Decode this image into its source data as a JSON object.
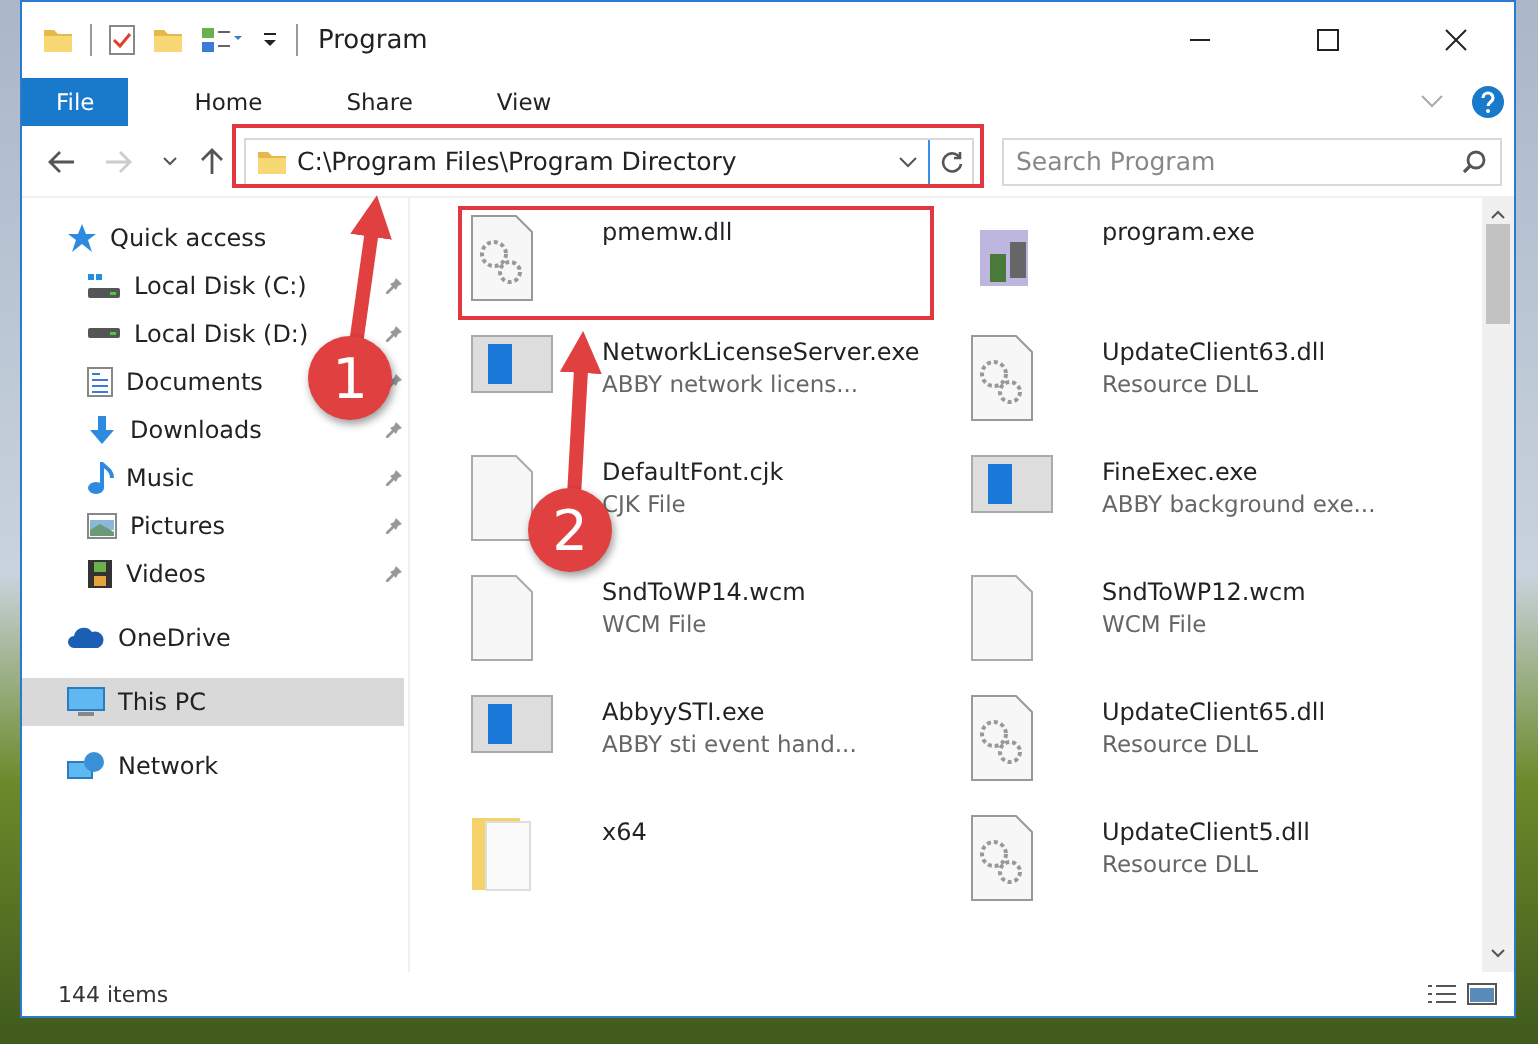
{
  "window": {
    "title": "Program"
  },
  "ribbon_tabs": [
    {
      "label": "File",
      "selected": true
    },
    {
      "label": "Home",
      "selected": false
    },
    {
      "label": "Share",
      "selected": false
    },
    {
      "label": "View",
      "selected": false
    }
  ],
  "address_bar": {
    "path": "C:\\Program Files\\Program Directory"
  },
  "search": {
    "placeholder": "Search Program"
  },
  "sidebar": {
    "items": [
      {
        "label": "Quick access",
        "selected": false,
        "children": [
          {
            "label": "Local Disk (C:)",
            "pinned": true,
            "selected": false
          },
          {
            "label": "Local Disk (D:)",
            "pinned": true,
            "selected": false
          },
          {
            "label": "Documents",
            "pinned": true,
            "selected": false
          },
          {
            "label": "Downloads",
            "pinned": true,
            "selected": false
          },
          {
            "label": "Music",
            "pinned": true,
            "selected": false
          },
          {
            "label": "Pictures",
            "pinned": true,
            "selected": false
          },
          {
            "label": "Videos",
            "pinned": true,
            "selected": false
          }
        ]
      },
      {
        "label": "OneDrive",
        "selected": false
      },
      {
        "label": "This PC",
        "selected": true
      },
      {
        "label": "Network",
        "selected": false
      }
    ]
  },
  "files": [
    {
      "name": "pmemw.dll",
      "kind": "gear-doc"
    },
    {
      "name": "program.exe",
      "kind": "installer"
    },
    {
      "name": "NetworkLicenseServer.exe",
      "description": "ABBY network licens...",
      "kind": "app"
    },
    {
      "name": "UpdateClient63.dll",
      "description": "Resource DLL",
      "kind": "gear-doc"
    },
    {
      "name": "DefaultFont.cjk",
      "description": "CJK File",
      "kind": "doc"
    },
    {
      "name": "FineExec.exe",
      "description": "ABBY background exe...",
      "kind": "app"
    },
    {
      "name": "SndToWP14.wcm",
      "description": "WCM File",
      "kind": "doc"
    },
    {
      "name": "SndToWP12.wcm",
      "description": "WCM File",
      "kind": "doc"
    },
    {
      "name": "AbbyySTI.exe",
      "description": "ABBY sti event hand...",
      "kind": "app"
    },
    {
      "name": "UpdateClient65.dll",
      "description": "Resource DLL",
      "kind": "gear-doc"
    },
    {
      "name": "x64",
      "kind": "folder"
    },
    {
      "name": "UpdateClient5.dll",
      "description": "Resource DLL",
      "kind": "gear-doc"
    }
  ],
  "status_bar": {
    "item_count": "144 items"
  },
  "annotations": [
    {
      "label": "1"
    },
    {
      "label": "2"
    }
  ]
}
